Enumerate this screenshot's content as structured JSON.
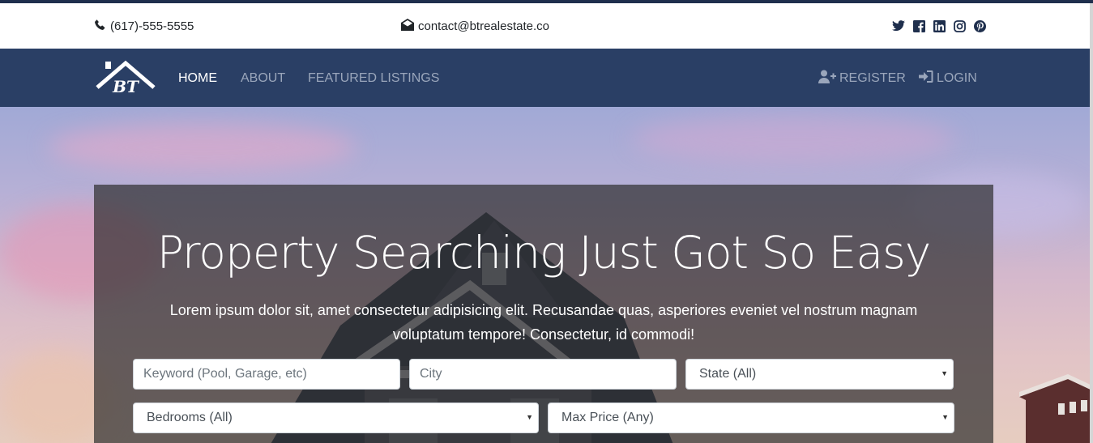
{
  "topbar": {
    "phone": "(617)-555-5555",
    "email": "contact@btrealestate.co",
    "icons": [
      "phone-icon",
      "envelope-icon",
      "twitter-icon",
      "facebook-icon",
      "linkedin-icon",
      "instagram-icon",
      "pinterest-icon"
    ]
  },
  "brand": {
    "logo_text": "BT"
  },
  "nav": {
    "home": "HOME",
    "about": "ABOUT",
    "featured": "FEATURED LISTINGS",
    "register": "REGISTER",
    "login": "LOGIN"
  },
  "hero": {
    "title": "Property Searching Just Got So Easy",
    "text": "Lorem ipsum dolor sit, amet consectetur adipisicing elit. Recusandae quas, asperiores eveniet vel nostrum magnam voluptatum tempore! Consectetur, id commodi!"
  },
  "search": {
    "keyword_placeholder": "Keyword (Pool, Garage, etc)",
    "city_placeholder": "City",
    "state_value": "State (All)",
    "bedrooms_value": "Bedrooms (All)",
    "max_price_value": "Max Price (Any)"
  },
  "colors": {
    "navbar": "#2a3f65",
    "nav_active": "#ffffff",
    "nav_inactive": "#9aa6bb"
  }
}
